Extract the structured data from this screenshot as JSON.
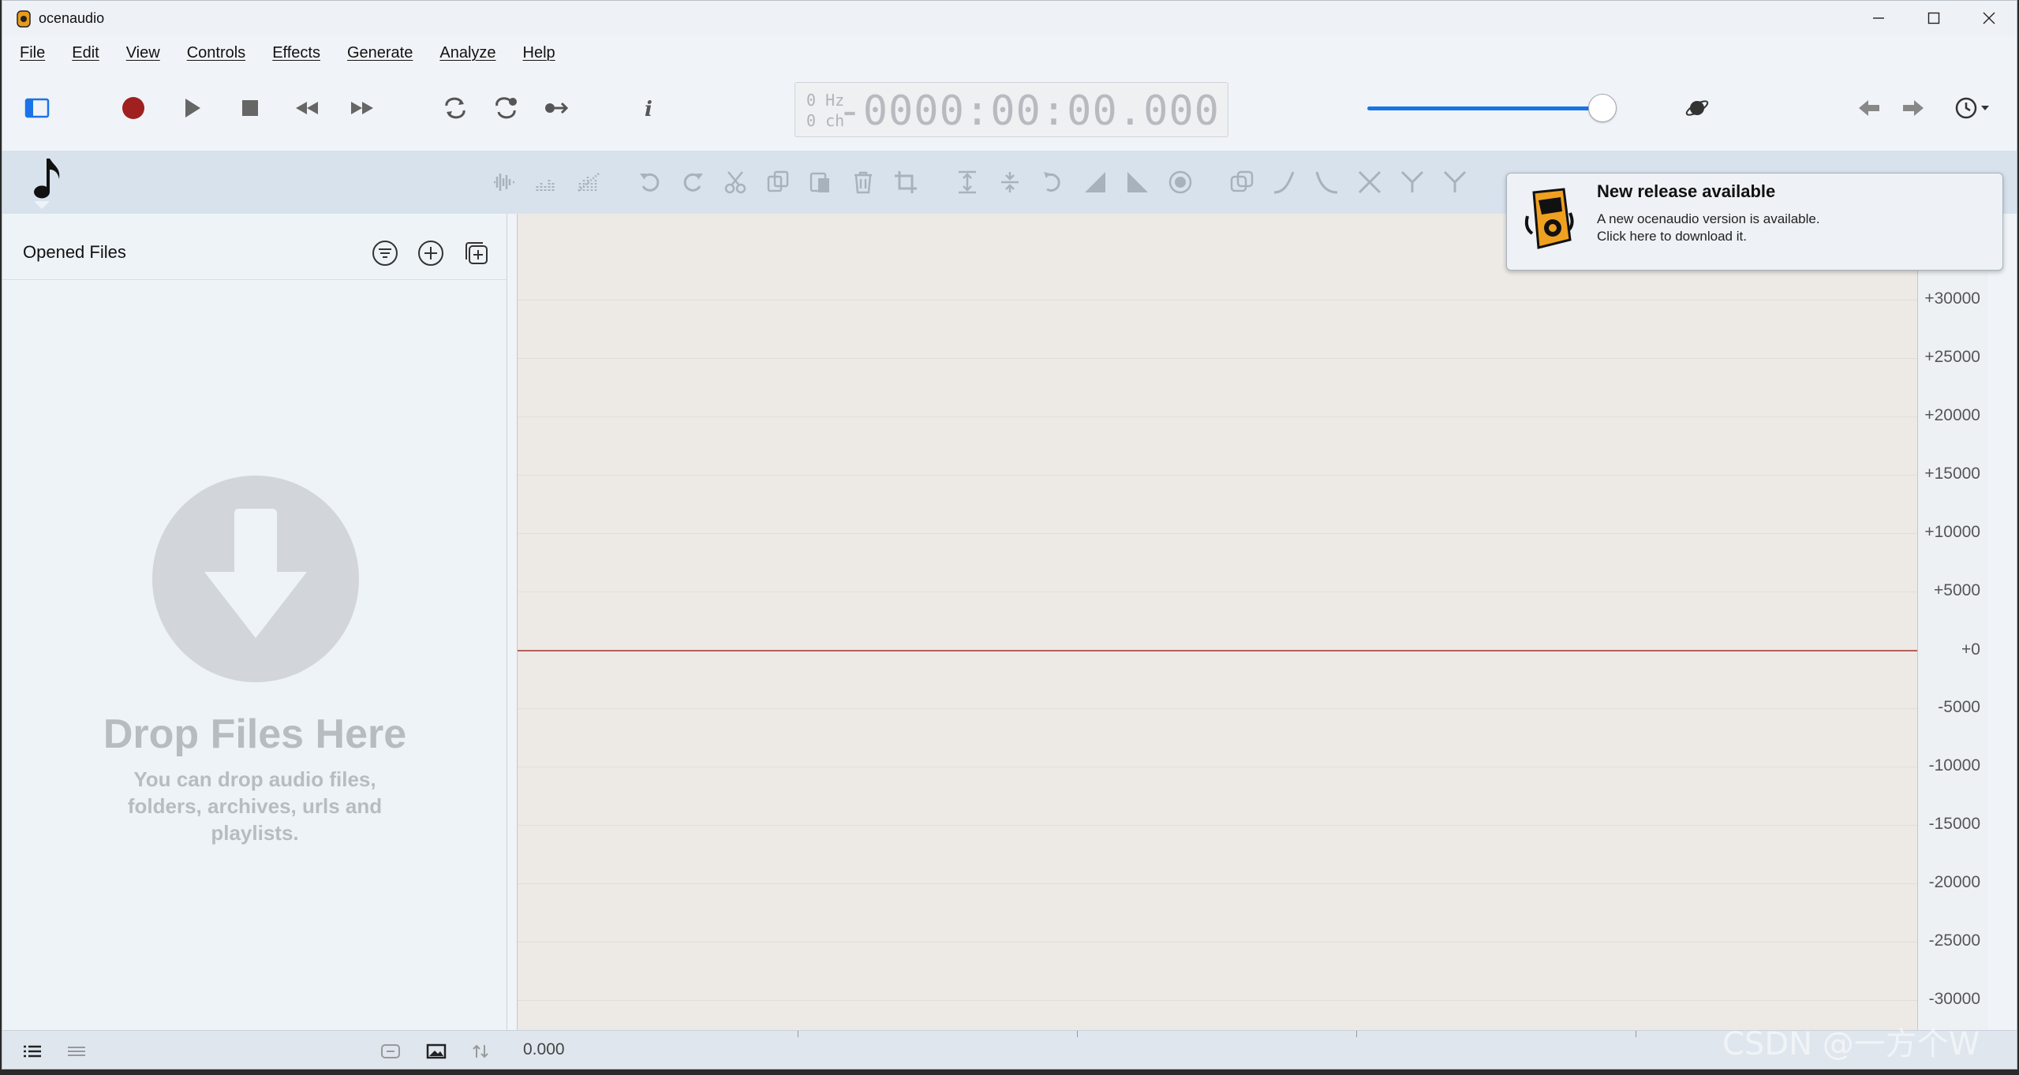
{
  "window": {
    "title": "ocenaudio"
  },
  "menu": [
    "File",
    "Edit",
    "View",
    "Controls",
    "Effects",
    "Generate",
    "Analyze",
    "Help"
  ],
  "display": {
    "hz": "0 Hz",
    "ch": "0 ch",
    "time": "-0000:00:00.000"
  },
  "volume": {
    "level": 0.96
  },
  "sidebar": {
    "title": "Opened Files",
    "drop_title": "Drop Files Here",
    "drop_subtitle": "You can drop audio files, folders, archives, urls and playlists."
  },
  "scale": {
    "labels": [
      "+30000",
      "+25000",
      "+20000",
      "+15000",
      "+10000",
      "+5000",
      "+0",
      "-5000",
      "-10000",
      "-15000",
      "-20000",
      "-25000",
      "-30000"
    ]
  },
  "timeline": {
    "start": "0.000"
  },
  "notification": {
    "title": "New release available",
    "line1": "A new ocenaudio version is available.",
    "line2": "Click here to download it."
  },
  "watermark": "CSDN @一方个W",
  "colors": {
    "accent": "#1a73e8",
    "record": "#a01f1f",
    "zero_line": "#b5605a"
  }
}
